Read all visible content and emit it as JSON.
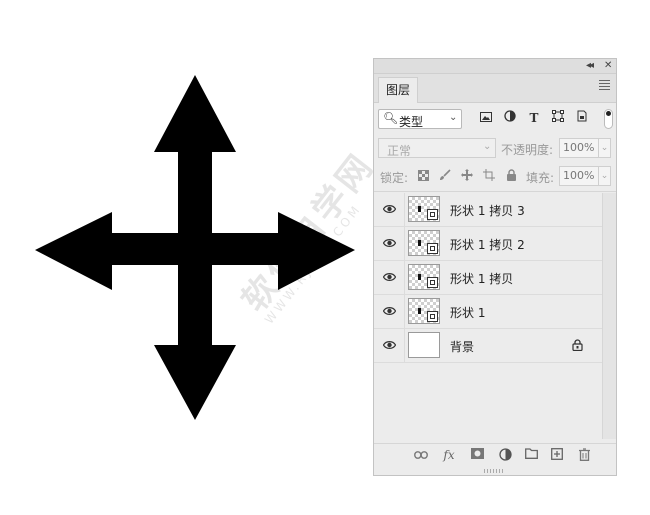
{
  "canvas": {
    "arrow_color": "#000000",
    "watermark": "软件自学网",
    "watermark_sub": "WWW.RJZXW.COM"
  },
  "panel": {
    "collapse_glyph": "◂◂",
    "close_glyph": "✕",
    "tab_label": "图层",
    "filter": {
      "label": "类型"
    },
    "blend_mode": "正常",
    "opacity_label": "不透明度:",
    "opacity_value": "100%",
    "lock_label": "锁定:",
    "fill_label": "填充:",
    "fill_value": "100%",
    "layers": [
      {
        "name": "形状 1 拷贝 3",
        "visible": true,
        "locked": false,
        "thumb": "shape"
      },
      {
        "name": "形状 1 拷贝 2",
        "visible": true,
        "locked": false,
        "thumb": "shape"
      },
      {
        "name": "形状 1 拷贝",
        "visible": true,
        "locked": false,
        "thumb": "shape"
      },
      {
        "name": "形状 1",
        "visible": true,
        "locked": false,
        "thumb": "shape"
      },
      {
        "name": "背景",
        "visible": true,
        "locked": true,
        "thumb": "white"
      }
    ],
    "bottom_icons": [
      "link-icon",
      "fx-icon",
      "mask-icon",
      "adjustment-icon",
      "folder-icon",
      "new-layer-icon",
      "trash-icon"
    ],
    "fx_label": "fx"
  }
}
